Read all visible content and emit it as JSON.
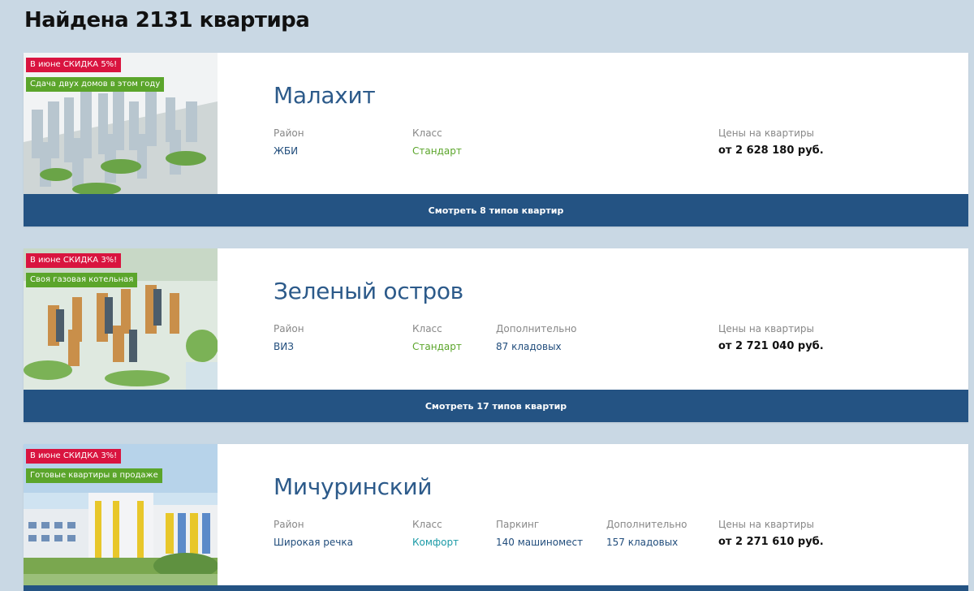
{
  "results": {
    "title": "Найдена 2131 квартира"
  },
  "labels": {
    "district": "Район",
    "class": "Класс",
    "extra": "Дополнительно",
    "parking": "Паркинг",
    "price": "Цены на квартиры"
  },
  "projects": [
    {
      "name": "Малахит",
      "discount_badge": "В июне СКИДКА 5%!",
      "feature_badge": "Сдача двух домов в этом году",
      "district": "ЖБИ",
      "class": "Стандарт",
      "price": "от 2 628 180 руб.",
      "button": "Смотреть 8 типов квартир"
    },
    {
      "name": "Зеленый остров",
      "discount_badge": "В июне СКИДКА 3%!",
      "feature_badge": "Своя газовая котельная",
      "district": "ВИЗ",
      "class": "Стандарт",
      "extra": "87 кладовых",
      "price": "от 2 721 040 руб.",
      "button": "Смотреть 17 типов квартир"
    },
    {
      "name": "Мичуринский",
      "discount_badge": "В июне СКИДКА 3%!",
      "feature_badge": "Готовые квартиры в продаже",
      "district": "Широкая речка",
      "class": "Комфорт",
      "parking": "140 машиномест",
      "extra": "157 кладовых",
      "price": "от 2 271 610 руб."
    }
  ],
  "colors": {
    "background": "#c9d8e4",
    "accent_blue": "#245383",
    "title_blue": "#2c5a8a",
    "discount_red": "#d9143f",
    "feature_green": "#5ba52b",
    "comfort_teal": "#1a9aa6"
  }
}
